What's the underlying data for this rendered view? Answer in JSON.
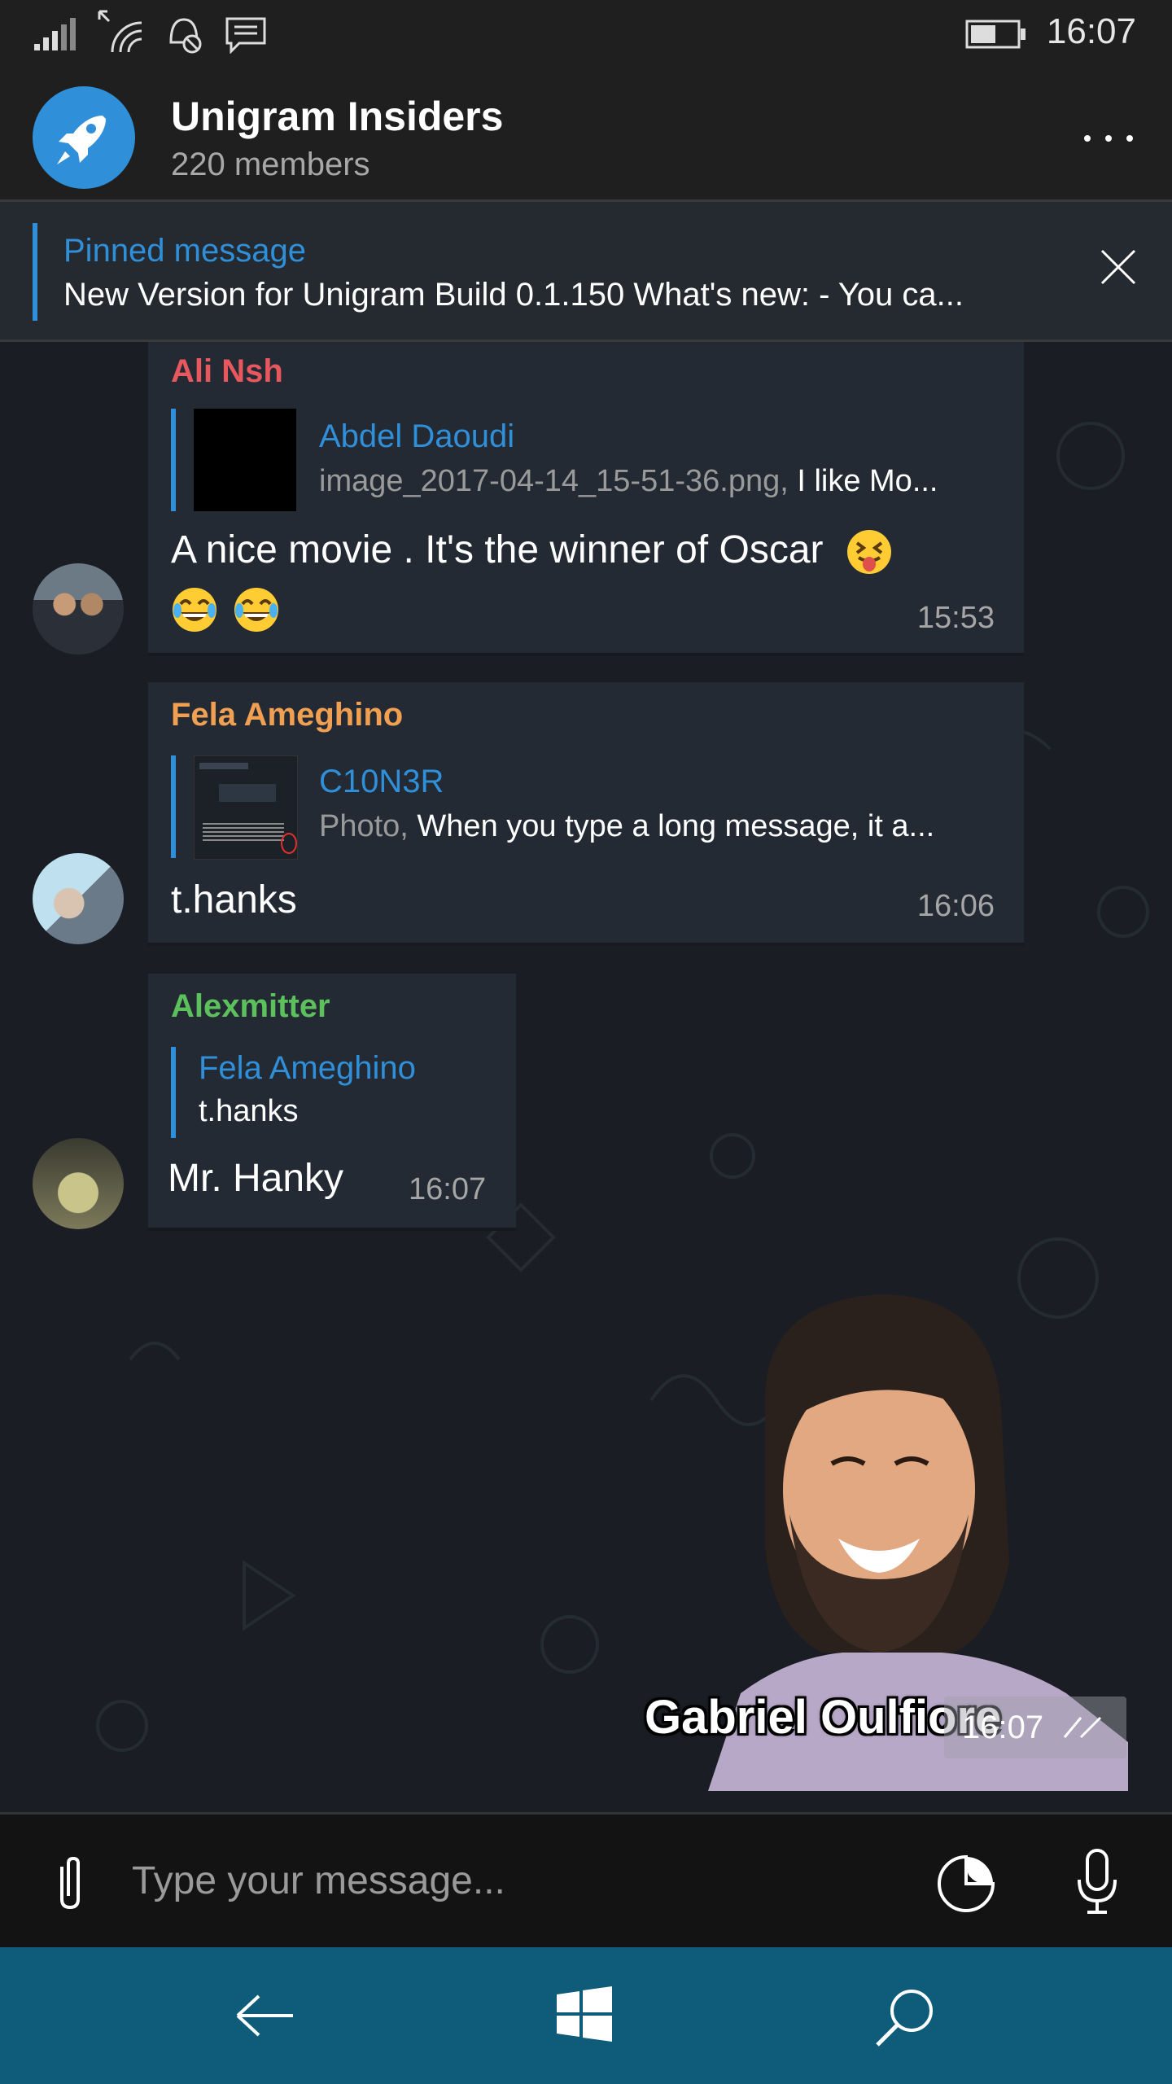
{
  "status_bar": {
    "time": "16:07"
  },
  "header": {
    "title": "Unigram Insiders",
    "subtitle": "220 members"
  },
  "pinned": {
    "title": "Pinned message",
    "text": "New Version for Unigram Build 0.1.150 What's new: - You ca..."
  },
  "messages": [
    {
      "sender": "Ali Nsh",
      "sender_color": "#e8565e",
      "reply_name": "Abdel Daoudi",
      "reply_type": "image_2017-04-14_15-51-36.png,",
      "reply_text": " I like Mo...",
      "text_line1": "A nice movie . It's the winner of Oscar",
      "time": "15:53"
    },
    {
      "sender": "Fela Ameghino",
      "sender_color": "#f0a050",
      "reply_name": "C10N3R",
      "reply_type": "Photo,",
      "reply_text": " When you type a long message, it a...",
      "text": "t.hanks",
      "time": "16:06"
    },
    {
      "sender": "Alexmitter",
      "sender_color": "#5cc05c",
      "reply_name": "Fela Ameghino",
      "reply_text": "t.hanks",
      "text": "Mr. Hanky",
      "time": "16:07"
    }
  ],
  "sticker": {
    "caption": "Gabriel Oulfiore",
    "time": "16:07"
  },
  "input": {
    "placeholder": "Type your message..."
  },
  "colors": {
    "accent": "#2f8fd8",
    "navbar": "#0e5b7a"
  }
}
